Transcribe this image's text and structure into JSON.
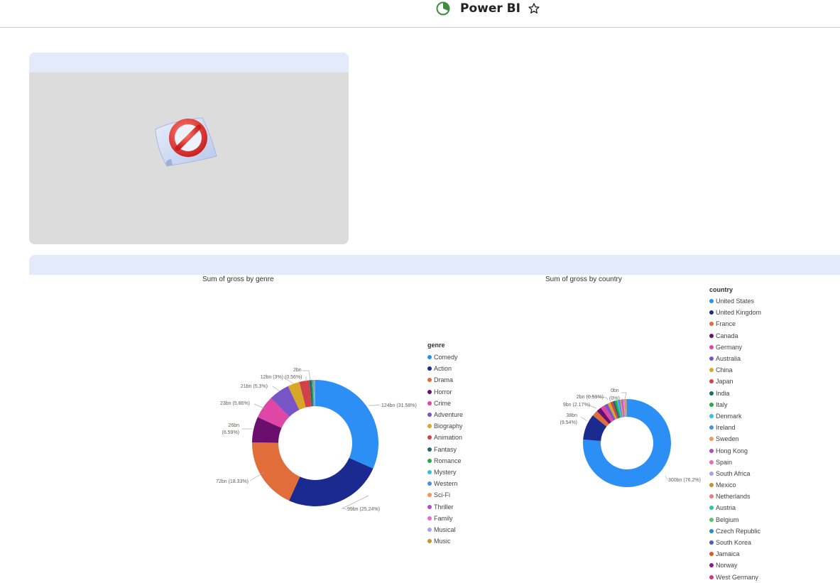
{
  "app": {
    "title": "Power BI",
    "logo_icon": "power-bi-logo-icon",
    "favorite_icon": "star-icon"
  },
  "image_panel": {
    "content_icon": "no-entry-icon"
  },
  "genre_chart": {
    "title": "Sum of gross by genre",
    "legend_title": "genre",
    "labels": [
      {
        "text": "124bn (31.58%)"
      },
      {
        "text": "99bn (25.24%)"
      },
      {
        "text": "72bn (18.33%)"
      },
      {
        "text": "26bn"
      },
      {
        "text": "(6.59%)"
      },
      {
        "text": "23bn (5.86%)"
      },
      {
        "text": "21bn (5.3%)"
      },
      {
        "text": "12bn (3%)"
      },
      {
        "text": "(0.56%)"
      },
      {
        "text": "2bn"
      }
    ],
    "legend": [
      {
        "name": "Comedy",
        "color": "#2b8ff5"
      },
      {
        "name": "Action",
        "color": "#1a2a8f"
      },
      {
        "name": "Drama",
        "color": "#e06d3a"
      },
      {
        "name": "Horror",
        "color": "#6b0f6e"
      },
      {
        "name": "Crime",
        "color": "#df46a6"
      },
      {
        "name": "Adventure",
        "color": "#7855c6"
      },
      {
        "name": "Biography",
        "color": "#d7a72a"
      },
      {
        "name": "Animation",
        "color": "#d1414a"
      },
      {
        "name": "Fantasy",
        "color": "#1f6b6b"
      },
      {
        "name": "Romance",
        "color": "#2aa84a"
      },
      {
        "name": "Mystery",
        "color": "#38bde0"
      },
      {
        "name": "Western",
        "color": "#4b8fe0"
      },
      {
        "name": "Sci-Fi",
        "color": "#f3945a"
      },
      {
        "name": "Thriller",
        "color": "#ad4fc6"
      },
      {
        "name": "Family",
        "color": "#e86bc9"
      },
      {
        "name": "Musical",
        "color": "#a8a3ee"
      },
      {
        "name": "Music",
        "color": "#c0962a"
      }
    ]
  },
  "country_chart": {
    "title": "Sum of gross by country",
    "legend_title": "country",
    "labels": [
      {
        "text": "300bn (76.2%)"
      },
      {
        "text": "38bn"
      },
      {
        "text": "(9.54%)"
      },
      {
        "text": "9bn (2.17%)"
      },
      {
        "text": "2bn (0.59%)"
      },
      {
        "text": "0bn"
      },
      {
        "text": "(0%)"
      }
    ],
    "legend": [
      {
        "name": "United States",
        "color": "#2b8ff5"
      },
      {
        "name": "United Kingdom",
        "color": "#1a2a8f"
      },
      {
        "name": "France",
        "color": "#e06d3a"
      },
      {
        "name": "Canada",
        "color": "#6b0f6e"
      },
      {
        "name": "Germany",
        "color": "#df46a6"
      },
      {
        "name": "Australia",
        "color": "#7855c6"
      },
      {
        "name": "China",
        "color": "#d7a72a"
      },
      {
        "name": "Japan",
        "color": "#d1414a"
      },
      {
        "name": "India",
        "color": "#1f6b6b"
      },
      {
        "name": "Italy",
        "color": "#2aa84a"
      },
      {
        "name": "Denmark",
        "color": "#38bde0"
      },
      {
        "name": "Ireland",
        "color": "#4b8fe0"
      },
      {
        "name": "Sweden",
        "color": "#f3945a"
      },
      {
        "name": "Hong Kong",
        "color": "#ad4fc6"
      },
      {
        "name": "Spain",
        "color": "#e86bc9"
      },
      {
        "name": "South Africa",
        "color": "#a8a3ee"
      },
      {
        "name": "Mexico",
        "color": "#c0962a"
      },
      {
        "name": "Netherlands",
        "color": "#f07a7a"
      },
      {
        "name": "Austria",
        "color": "#2ec4a8"
      },
      {
        "name": "Belgium",
        "color": "#5bc46a"
      },
      {
        "name": "Czech Republic",
        "color": "#1f8fcf"
      },
      {
        "name": "South Korea",
        "color": "#4a5fc0"
      },
      {
        "name": "Jamaica",
        "color": "#e0581c"
      },
      {
        "name": "Norway",
        "color": "#8a1a8a"
      },
      {
        "name": "West Germany",
        "color": "#d9357a"
      }
    ]
  },
  "chart_data": [
    {
      "type": "pie",
      "title": "Sum of gross by genre",
      "legend_title": "genre",
      "categories": [
        "Comedy",
        "Action",
        "Drama",
        "Horror",
        "Crime",
        "Adventure",
        "Biography",
        "Animation",
        "Fantasy",
        "Romance",
        "Mystery",
        "Western",
        "Sci-Fi",
        "Thriller",
        "Family",
        "Musical",
        "Music"
      ],
      "values": [
        31.58,
        25.24,
        18.33,
        6.59,
        5.86,
        5.3,
        3,
        2.6,
        0.56,
        0.3,
        0.2,
        0.15,
        0.1,
        0.08,
        0.05,
        0.03,
        0.03
      ]
    },
    {
      "type": "pie",
      "title": "Sum of gross by country",
      "legend_title": "country",
      "categories": [
        "United States",
        "United Kingdom",
        "France",
        "Canada",
        "Germany",
        "Australia",
        "China",
        "Japan",
        "India",
        "Italy",
        "Denmark",
        "Ireland",
        "Sweden",
        "Hong Kong",
        "Spain",
        "South Africa",
        "Mexico",
        "Netherlands",
        "Austria",
        "Belgium",
        "Czech Republic",
        "South Korea",
        "Jamaica",
        "Norway",
        "West Germany"
      ],
      "values": [
        76.2,
        9.54,
        2.17,
        1.8,
        1.6,
        1.3,
        1.1,
        0.9,
        0.8,
        0.7,
        0.6,
        0.59,
        0.5,
        0.45,
        0.4,
        0.3,
        0.3,
        0.2,
        0.1,
        0.1,
        0.1,
        0.05,
        0.05,
        0.02,
        0.01
      ]
    }
  ]
}
